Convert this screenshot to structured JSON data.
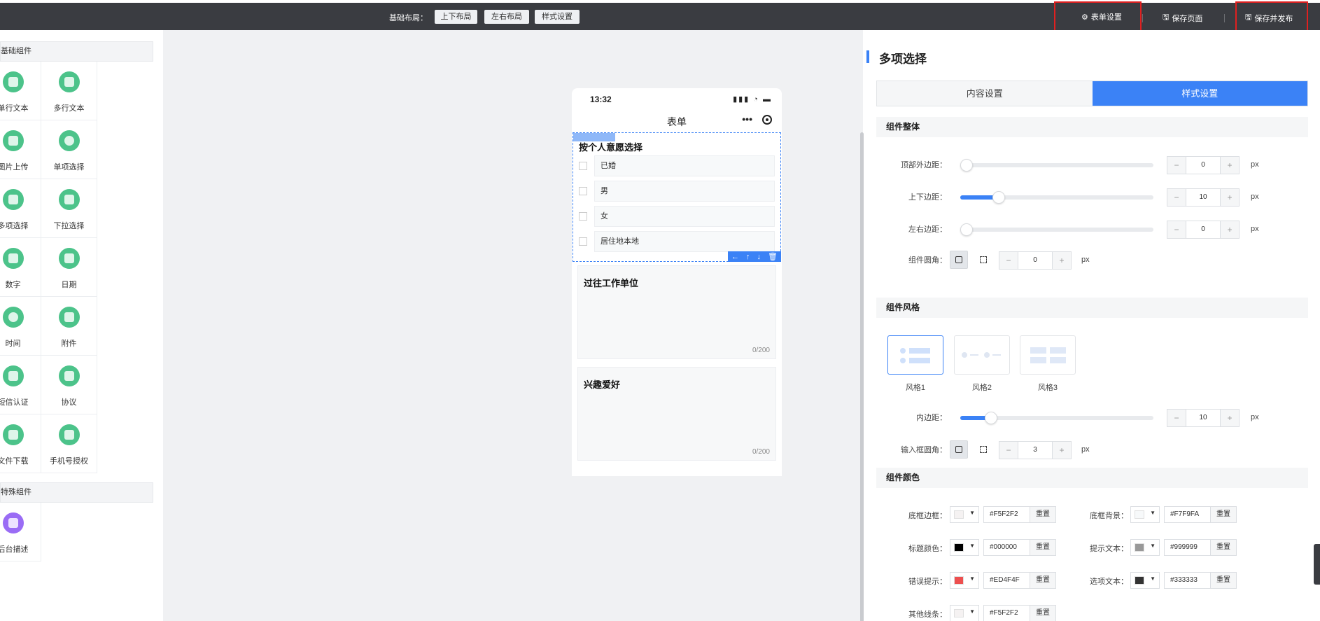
{
  "topbar": {
    "layout_label": "基础布局：",
    "layout_buttons": [
      "上下布局",
      "左右布局",
      "样式设置"
    ],
    "form_settings": "表单设置",
    "save_page": "保存页面",
    "save_publish": "保存并发布"
  },
  "left": {
    "basic_group": "基础组件",
    "basic_items": [
      "单行文本",
      "多行文本",
      "图片上传",
      "单项选择",
      "多项选择",
      "下拉选择",
      "数字",
      "日期",
      "时间",
      "附件",
      "短信认证",
      "协议",
      "文件下载",
      "手机号授权"
    ],
    "special_group": "特殊组件",
    "special_items": [
      "后台描述"
    ]
  },
  "phone": {
    "time": "13:32",
    "nav_title": "表单",
    "nav_more": "•••",
    "field1_title": "按个人意愿选择",
    "options": [
      "已婚",
      "男",
      "女",
      "居住地本地"
    ],
    "tools": [
      "←",
      "↑",
      "↓",
      "🗑"
    ],
    "field2_title": "过往工作单位",
    "field2_count": "0/200",
    "field3_title": "兴趣爱好",
    "field3_count": "0/200"
  },
  "right": {
    "title": "多项选择",
    "tab_content": "内容设置",
    "tab_style": "样式设置",
    "sec_overall": "组件整体",
    "top_margin_label": "顶部外边距：",
    "top_margin_value": "0",
    "top_margin_level": 0,
    "vpad_label": "上下边距：",
    "vpad_value": "10",
    "vpad_level": 0.2,
    "hpad_label": "左右边距：",
    "hpad_value": "0",
    "hpad_level": 0,
    "radius_label": "组件圆角：",
    "radius_value": "0",
    "unit": "px",
    "sec_style": "组件风格",
    "styles": [
      "风格1",
      "风格2",
      "风格3"
    ],
    "inner_pad_label": "内边距：",
    "inner_pad_value": "10",
    "inner_pad_level": 0.16,
    "input_radius_label": "输入框圆角：",
    "input_radius_value": "3",
    "sec_color": "组件颜色",
    "reset": "重置",
    "colors": [
      {
        "label": "底框边框：",
        "hex": "#F5F2F2",
        "chip": "#F5F2F2"
      },
      {
        "label": "底框背景：",
        "hex": "#F7F9FA",
        "chip": "#F7F9FA"
      },
      {
        "label": "标题颜色：",
        "hex": "#000000",
        "chip": "#000000"
      },
      {
        "label": "提示文本：",
        "hex": "#999999",
        "chip": "#999999"
      },
      {
        "label": "错误提示：",
        "hex": "#ED4F4F",
        "chip": "#ED4F4F"
      },
      {
        "label": "选项文本：",
        "hex": "#333333",
        "chip": "#333333"
      },
      {
        "label": "其他线条：",
        "hex": "#F5F2F2",
        "chip": "#F5F2F2"
      }
    ],
    "step_minus": "−",
    "step_plus": "+"
  },
  "accent_color": "#3B82F6"
}
